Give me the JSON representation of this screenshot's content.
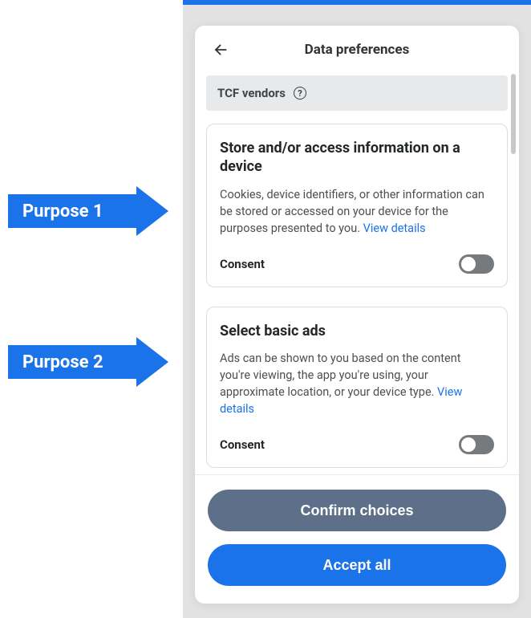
{
  "annotations": {
    "purpose1": "Purpose 1",
    "purpose2": "Purpose 2"
  },
  "modal": {
    "title": "Data preferences",
    "section_vendors": "TCF vendors",
    "help_glyph": "?",
    "cards": [
      {
        "title": "Store and/or access information on a device",
        "desc": "Cookies, device identifiers, or other information can be stored or accessed on your device for the purposes presented to you. ",
        "view_details": "View details",
        "consent_label": "Consent"
      },
      {
        "title": "Select basic ads",
        "desc": "Ads can be shown to you based on the content you're viewing, the app you're using, your approximate location, or your device type. ",
        "view_details": "View details",
        "consent_label": "Consent"
      }
    ],
    "confirm_label": "Confirm choices",
    "accept_label": "Accept all"
  }
}
